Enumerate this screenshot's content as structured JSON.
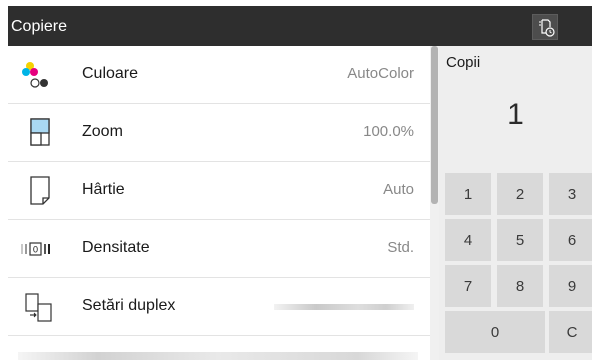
{
  "header": {
    "title": "Copiere",
    "job_icon": "job-list-icon"
  },
  "settings": [
    {
      "label": "Culoare",
      "value": "AutoColor",
      "icon": "color-icon"
    },
    {
      "label": "Zoom",
      "value": "100.0%",
      "icon": "zoom-icon"
    },
    {
      "label": "Hârtie",
      "value": "Auto",
      "icon": "paper-icon"
    },
    {
      "label": "Densitate",
      "value": "Std.",
      "icon": "density-icon"
    },
    {
      "label": "Setări duplex",
      "value": "",
      "icon": "duplex-icon"
    }
  ],
  "copies": {
    "label": "Copii",
    "count": "1"
  },
  "keypad": {
    "keys": [
      "1",
      "2",
      "3",
      "4",
      "5",
      "6",
      "7",
      "8",
      "9",
      "0",
      "C"
    ]
  }
}
